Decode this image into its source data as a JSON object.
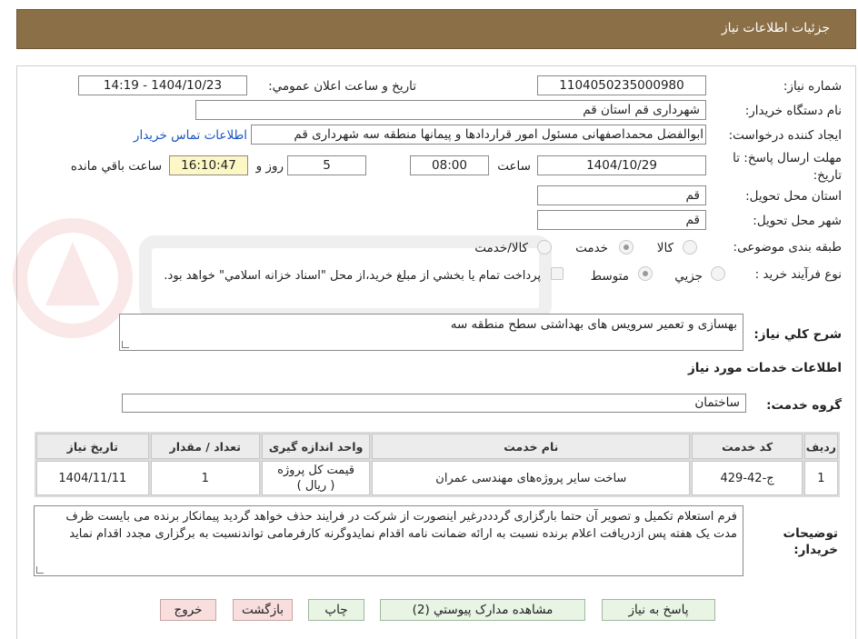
{
  "header": {
    "title": "جزئيات اطلاعات نياز"
  },
  "form": {
    "need_number": {
      "label": "شماره نياز:",
      "value": "1104050235000980"
    },
    "announce_date": {
      "label": "تاريخ و ساعت اعلان عمومي:",
      "value": "1404/10/23 - 14:19"
    },
    "buyer_org": {
      "label": "نام دستگاه خريدار:",
      "value": "شهرداری قم استان قم"
    },
    "requester": {
      "label": "ايجاد کننده درخواست:",
      "value": "ابوالفضل محمداصفهانی مسئول امور قراردادها و پیمانها منطقه سه شهرداری قم",
      "contact_link": "اطلاعات تماس خريدار"
    },
    "deadline": {
      "label": "مهلت ارسال پاسخ: تا تاريخ:",
      "date": "1404/10/29",
      "time_label": "ساعت",
      "time": "08:00",
      "days": "5",
      "days_label": "روز و",
      "remaining": "16:10:47",
      "remaining_label": "ساعت باقي مانده"
    },
    "delivery_province": {
      "label": "استان محل تحويل:",
      "value": "قم"
    },
    "delivery_city": {
      "label": "شهر محل تحويل:",
      "value": "قم"
    },
    "category": {
      "label": "طبقه بندی موضوعی:",
      "options": [
        "کالا",
        "خدمت",
        "کالا/خدمت"
      ],
      "selected": "خدمت"
    },
    "process": {
      "label": "نوع فرآيند خريد :",
      "options": [
        "جزيي",
        "متوسط"
      ],
      "selected": "متوسط",
      "payment_note": "پرداخت تمام يا بخشي از مبلغ خريد،از محل \"اسناد خزانه اسلامي\" خواهد بود."
    }
  },
  "description": {
    "label": "شرح کلي نياز:",
    "value": "بهسازی و تعمیر سرویس های بهداشتی سطح منطقه سه"
  },
  "services_title": "اطلاعات خدمات مورد نياز",
  "service_group": {
    "label": "گروه خدمت:",
    "value": "ساختمان"
  },
  "table": {
    "headers": [
      "رديف",
      "کد خدمت",
      "نام خدمت",
      "واحد اندازه گيری",
      "تعداد / مقدار",
      "تاريخ نياز"
    ],
    "rows": [
      [
        "1",
        "ج-42-429",
        "ساخت سایر پروژه‌های مهندسی عمران",
        "قیمت کل پروژه ( ریال )",
        "1",
        "1404/11/11"
      ]
    ]
  },
  "buyer_notes": {
    "label": "توضيحات خريدار:",
    "value": "فرم استعلام تکمیل و تصویر آن حتما بارگزاری گردددرغیر اینصورت از شرکت در فرایند حذف خواهد گردید پیمانکار برنده می بایست ظرف مدت یک هفته پس ازدریافت اعلام برنده نسبت به ارائه ضمانت نامه اقدام نمایدوگرنه کارفرمامی تواندنسبت به برگزاری مجدد اقدام نماید"
  },
  "buttons": {
    "reply": "پاسخ به نياز",
    "attachments": "مشاهده مدارک پيوستي (2)",
    "print": "چاپ",
    "back": "بازگشت",
    "exit": "خروج"
  },
  "colors": {
    "header": "#8b6f47",
    "button_green": "#e8f4e4",
    "button_pink": "#f9dede",
    "link": "#1a55c4"
  }
}
